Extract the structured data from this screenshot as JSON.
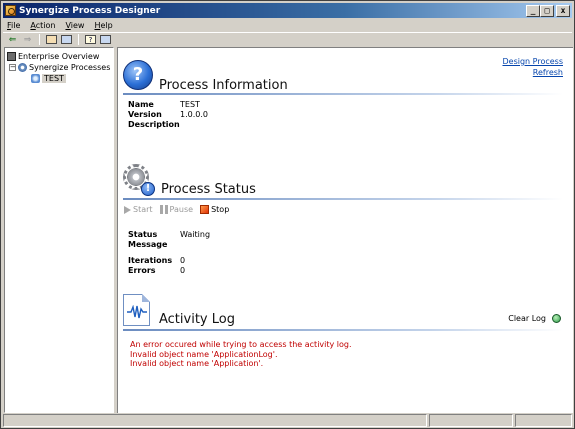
{
  "window": {
    "title": "Synergize Process Designer",
    "controls": {
      "minimize": "_",
      "maximize": "□",
      "close": "x"
    }
  },
  "menu": [
    {
      "label": "File",
      "accel": "F",
      "rest": "ile"
    },
    {
      "label": "Action",
      "accel": "A",
      "rest": "ction"
    },
    {
      "label": "View",
      "accel": "V",
      "rest": "iew"
    },
    {
      "label": "Help",
      "accel": "H",
      "rest": "elp"
    }
  ],
  "toolbar": {
    "back_icon": "back-arrow-icon",
    "forward_icon": "forward-arrow-icon",
    "up_icon": "up-folder-icon",
    "tree_icon": "show-hide-tree-icon",
    "help_icon": "help-icon",
    "console_icon": "console-icon"
  },
  "tree": {
    "root": "Enterprise Overview",
    "group": "Synergize Processes",
    "item": "TEST"
  },
  "links": {
    "design": "Design Process",
    "refresh": "Refresh"
  },
  "process_info": {
    "title": "Process Information",
    "icon": "?",
    "name_label": "Name",
    "name_value": "TEST",
    "version_label": "Version",
    "version_value": "1.0.0.0",
    "description_label": "Description",
    "description_value": ""
  },
  "process_status": {
    "title": "Process Status",
    "badge": "!",
    "start": "Start",
    "pause": "Pause",
    "stop": "Stop",
    "status_label": "Status",
    "status_value": "Waiting",
    "message_label": "Message",
    "message_value": "",
    "iterations_label": "Iterations",
    "iterations_value": "0",
    "errors_label": "Errors",
    "errors_value": "0"
  },
  "activity_log": {
    "title": "Activity Log",
    "clear": "Clear Log",
    "lines": [
      "An error occured while trying to access the activity log.",
      "Invalid object name 'ApplicationLog'.",
      "Invalid object name 'Application'."
    ]
  },
  "colors": {
    "title_start": "#0a246a",
    "link": "#0645ad",
    "error": "#c00000",
    "face": "#d4d0c8"
  }
}
